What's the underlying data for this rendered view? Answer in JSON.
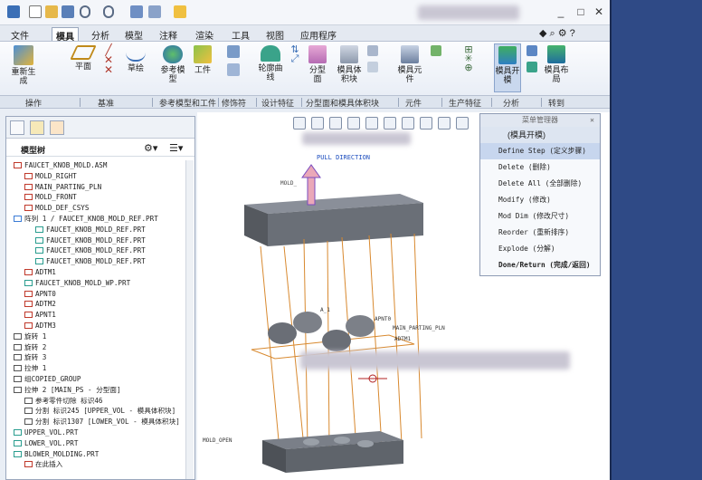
{
  "ribbon_tabs": [
    "文件",
    "模具",
    "分析",
    "模型",
    "注释",
    "渲染",
    "工具",
    "视图",
    "应用程序"
  ],
  "active_tab": "模具",
  "ribbon": {
    "regen": "重新生成",
    "plane": "平面",
    "sketch": "草绘",
    "ref_model": "参考模型",
    "workpiece": "工件",
    "silhouette": "轮廓曲线",
    "parting_surface": "分型面",
    "mold_volume": "模具体积块",
    "mold_component": "模具元件",
    "mold_open": "模具开模",
    "mold_layout": "模具布局"
  },
  "groups": [
    "操作",
    "基准",
    "参考模型和工件",
    "修饰符",
    "设计特征",
    "分型面和模具体积块",
    "元件",
    "生产特征",
    "分析",
    "转到"
  ],
  "tree": {
    "title": "模型树",
    "items": [
      {
        "text": "FAUCET_KNOB_MOLD.ASM",
        "indent": 0,
        "color": "#c0392b"
      },
      {
        "text": "MOLD_RIGHT",
        "indent": 1,
        "color": "#c0392b"
      },
      {
        "text": "MAIN_PARTING_PLN",
        "indent": 1,
        "color": "#c0392b"
      },
      {
        "text": "MOLD_FRONT",
        "indent": 1,
        "color": "#c0392b"
      },
      {
        "text": "MOLD_DEF_CSYS",
        "indent": 1,
        "color": "#c0392b"
      },
      {
        "text": "阵列 1 / FAUCET_KNOB_MOLD_REF.PRT",
        "indent": 0,
        "color": "#3a7bd5"
      },
      {
        "text": "FAUCET_KNOB_MOLD_REF.PRT",
        "indent": 2,
        "color": "#2a9d8f"
      },
      {
        "text": "FAUCET_KNOB_MOLD_REF.PRT",
        "indent": 2,
        "color": "#2a9d8f"
      },
      {
        "text": "FAUCET_KNOB_MOLD_REF.PRT",
        "indent": 2,
        "color": "#2a9d8f"
      },
      {
        "text": "FAUCET_KNOB_MOLD_REF.PRT",
        "indent": 2,
        "color": "#2a9d8f"
      },
      {
        "text": "ADTM1",
        "indent": 1,
        "color": "#c0392b"
      },
      {
        "text": "FAUCET_KNOB_MOLD_WP.PRT",
        "indent": 1,
        "color": "#2a9d8f"
      },
      {
        "text": "APNT0",
        "indent": 1,
        "color": "#c0392b"
      },
      {
        "text": "ADTM2",
        "indent": 1,
        "color": "#c0392b"
      },
      {
        "text": "APNT1",
        "indent": 1,
        "color": "#c0392b"
      },
      {
        "text": "ADTM3",
        "indent": 1,
        "color": "#c0392b"
      },
      {
        "text": "旋转 1",
        "indent": 0,
        "color": "#555"
      },
      {
        "text": "旋转 2",
        "indent": 0,
        "color": "#555"
      },
      {
        "text": "旋转 3",
        "indent": 0,
        "color": "#555"
      },
      {
        "text": "拉伸 1",
        "indent": 0,
        "color": "#555"
      },
      {
        "text": "组COPIED_GROUP",
        "indent": 0,
        "color": "#555"
      },
      {
        "text": "拉伸 2 [MAIN_PS - 分型面]",
        "indent": 0,
        "color": "#555"
      },
      {
        "text": "参考零件切除 标识46",
        "indent": 1,
        "color": "#555"
      },
      {
        "text": "分割 标识245 [UPPER_VOL - 模具体积块]",
        "indent": 1,
        "color": "#555"
      },
      {
        "text": "分割 标识1307 [LOWER_VOL - 模具体积块]",
        "indent": 1,
        "color": "#555"
      },
      {
        "text": "UPPER_VOL.PRT",
        "indent": 0,
        "color": "#2a9d8f"
      },
      {
        "text": "LOWER_VOL.PRT",
        "indent": 0,
        "color": "#2a9d8f"
      },
      {
        "text": "BLOWER_MOLDING.PRT",
        "indent": 0,
        "color": "#2a9d8f"
      },
      {
        "text": "在此插入",
        "indent": 1,
        "color": "#c0392b"
      }
    ]
  },
  "viewport": {
    "pull_direction": "PULL DIRECTION",
    "main_parting": "MAIN_PARTING_PLN",
    "adtm1": "ADTM1",
    "apnt0": "APNT0",
    "a1": "A_1",
    "mold_label": "MOLD_",
    "mold_open": "MOLD_OPEN"
  },
  "menu_manager": {
    "title": "菜单管理器",
    "header": "(模具开模)",
    "items": [
      {
        "label": "Define Step  (定义步骤)",
        "selected": true
      },
      {
        "label": "Delete  (删除)",
        "selected": false
      },
      {
        "label": "Delete All  (全部删除)",
        "selected": false
      },
      {
        "label": "Modify  (修改)",
        "selected": false
      },
      {
        "label": "Mod Dim  (修改尺寸)",
        "selected": false
      },
      {
        "label": "Reorder  (重新排序)",
        "selected": false
      },
      {
        "label": "Explode  (分解)",
        "selected": false
      },
      {
        "label": "Done/Return  (完成/返回)",
        "selected": false
      }
    ]
  }
}
